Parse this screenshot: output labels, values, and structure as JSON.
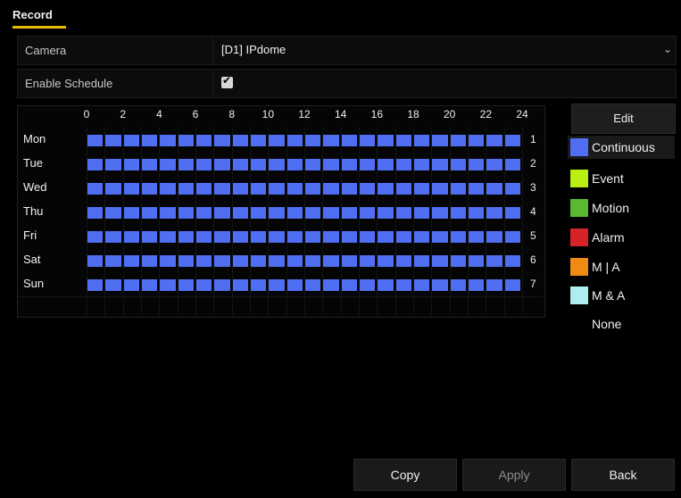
{
  "tab": {
    "label": "Record"
  },
  "form": {
    "camera": {
      "label": "Camera",
      "value": "[D1] IPdome",
      "chevron": "⌄"
    },
    "enable_schedule": {
      "label": "Enable Schedule",
      "checked": true,
      "tick": "✔"
    }
  },
  "schedule": {
    "hours": [
      "0",
      "2",
      "4",
      "6",
      "8",
      "10",
      "12",
      "14",
      "16",
      "18",
      "20",
      "22",
      "24"
    ],
    "days": [
      "Mon",
      "Tue",
      "Wed",
      "Thu",
      "Fri",
      "Sat",
      "Sun"
    ],
    "row_numbers": [
      "1",
      "2",
      "3",
      "4",
      "5",
      "6",
      "7"
    ],
    "mode": "Continuous",
    "color": "#4f6ef2"
  },
  "sidebar": {
    "edit_label": "Edit",
    "legend": [
      {
        "label": "Continuous",
        "color": "#4f6ef2"
      },
      {
        "label": "Event",
        "color": "#b9ef11"
      },
      {
        "label": "Motion",
        "color": "#5ab833"
      },
      {
        "label": "Alarm",
        "color": "#d6232a"
      },
      {
        "label": "M | A",
        "color": "#ef8a12"
      },
      {
        "label": "M & A",
        "color": "#aeeef0"
      },
      {
        "label": "None",
        "color": "#000000"
      }
    ]
  },
  "buttons": {
    "copy": "Copy",
    "apply": "Apply",
    "back": "Back"
  }
}
